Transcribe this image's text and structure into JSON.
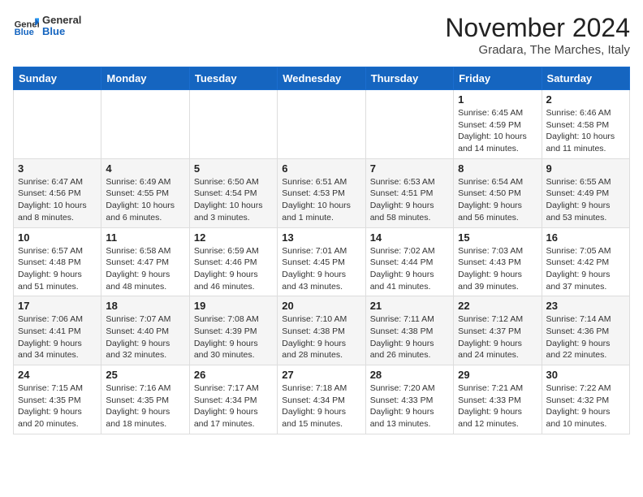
{
  "header": {
    "logo": {
      "general": "General",
      "blue": "Blue"
    },
    "title": "November 2024",
    "location": "Gradara, The Marches, Italy"
  },
  "days_of_week": [
    "Sunday",
    "Monday",
    "Tuesday",
    "Wednesday",
    "Thursday",
    "Friday",
    "Saturday"
  ],
  "weeks": [
    [
      {
        "day": "",
        "info": ""
      },
      {
        "day": "",
        "info": ""
      },
      {
        "day": "",
        "info": ""
      },
      {
        "day": "",
        "info": ""
      },
      {
        "day": "",
        "info": ""
      },
      {
        "day": "1",
        "info": "Sunrise: 6:45 AM\nSunset: 4:59 PM\nDaylight: 10 hours and 14 minutes."
      },
      {
        "day": "2",
        "info": "Sunrise: 6:46 AM\nSunset: 4:58 PM\nDaylight: 10 hours and 11 minutes."
      }
    ],
    [
      {
        "day": "3",
        "info": "Sunrise: 6:47 AM\nSunset: 4:56 PM\nDaylight: 10 hours and 8 minutes."
      },
      {
        "day": "4",
        "info": "Sunrise: 6:49 AM\nSunset: 4:55 PM\nDaylight: 10 hours and 6 minutes."
      },
      {
        "day": "5",
        "info": "Sunrise: 6:50 AM\nSunset: 4:54 PM\nDaylight: 10 hours and 3 minutes."
      },
      {
        "day": "6",
        "info": "Sunrise: 6:51 AM\nSunset: 4:53 PM\nDaylight: 10 hours and 1 minute."
      },
      {
        "day": "7",
        "info": "Sunrise: 6:53 AM\nSunset: 4:51 PM\nDaylight: 9 hours and 58 minutes."
      },
      {
        "day": "8",
        "info": "Sunrise: 6:54 AM\nSunset: 4:50 PM\nDaylight: 9 hours and 56 minutes."
      },
      {
        "day": "9",
        "info": "Sunrise: 6:55 AM\nSunset: 4:49 PM\nDaylight: 9 hours and 53 minutes."
      }
    ],
    [
      {
        "day": "10",
        "info": "Sunrise: 6:57 AM\nSunset: 4:48 PM\nDaylight: 9 hours and 51 minutes."
      },
      {
        "day": "11",
        "info": "Sunrise: 6:58 AM\nSunset: 4:47 PM\nDaylight: 9 hours and 48 minutes."
      },
      {
        "day": "12",
        "info": "Sunrise: 6:59 AM\nSunset: 4:46 PM\nDaylight: 9 hours and 46 minutes."
      },
      {
        "day": "13",
        "info": "Sunrise: 7:01 AM\nSunset: 4:45 PM\nDaylight: 9 hours and 43 minutes."
      },
      {
        "day": "14",
        "info": "Sunrise: 7:02 AM\nSunset: 4:44 PM\nDaylight: 9 hours and 41 minutes."
      },
      {
        "day": "15",
        "info": "Sunrise: 7:03 AM\nSunset: 4:43 PM\nDaylight: 9 hours and 39 minutes."
      },
      {
        "day": "16",
        "info": "Sunrise: 7:05 AM\nSunset: 4:42 PM\nDaylight: 9 hours and 37 minutes."
      }
    ],
    [
      {
        "day": "17",
        "info": "Sunrise: 7:06 AM\nSunset: 4:41 PM\nDaylight: 9 hours and 34 minutes."
      },
      {
        "day": "18",
        "info": "Sunrise: 7:07 AM\nSunset: 4:40 PM\nDaylight: 9 hours and 32 minutes."
      },
      {
        "day": "19",
        "info": "Sunrise: 7:08 AM\nSunset: 4:39 PM\nDaylight: 9 hours and 30 minutes."
      },
      {
        "day": "20",
        "info": "Sunrise: 7:10 AM\nSunset: 4:38 PM\nDaylight: 9 hours and 28 minutes."
      },
      {
        "day": "21",
        "info": "Sunrise: 7:11 AM\nSunset: 4:38 PM\nDaylight: 9 hours and 26 minutes."
      },
      {
        "day": "22",
        "info": "Sunrise: 7:12 AM\nSunset: 4:37 PM\nDaylight: 9 hours and 24 minutes."
      },
      {
        "day": "23",
        "info": "Sunrise: 7:14 AM\nSunset: 4:36 PM\nDaylight: 9 hours and 22 minutes."
      }
    ],
    [
      {
        "day": "24",
        "info": "Sunrise: 7:15 AM\nSunset: 4:35 PM\nDaylight: 9 hours and 20 minutes."
      },
      {
        "day": "25",
        "info": "Sunrise: 7:16 AM\nSunset: 4:35 PM\nDaylight: 9 hours and 18 minutes."
      },
      {
        "day": "26",
        "info": "Sunrise: 7:17 AM\nSunset: 4:34 PM\nDaylight: 9 hours and 17 minutes."
      },
      {
        "day": "27",
        "info": "Sunrise: 7:18 AM\nSunset: 4:34 PM\nDaylight: 9 hours and 15 minutes."
      },
      {
        "day": "28",
        "info": "Sunrise: 7:20 AM\nSunset: 4:33 PM\nDaylight: 9 hours and 13 minutes."
      },
      {
        "day": "29",
        "info": "Sunrise: 7:21 AM\nSunset: 4:33 PM\nDaylight: 9 hours and 12 minutes."
      },
      {
        "day": "30",
        "info": "Sunrise: 7:22 AM\nSunset: 4:32 PM\nDaylight: 9 hours and 10 minutes."
      }
    ]
  ]
}
